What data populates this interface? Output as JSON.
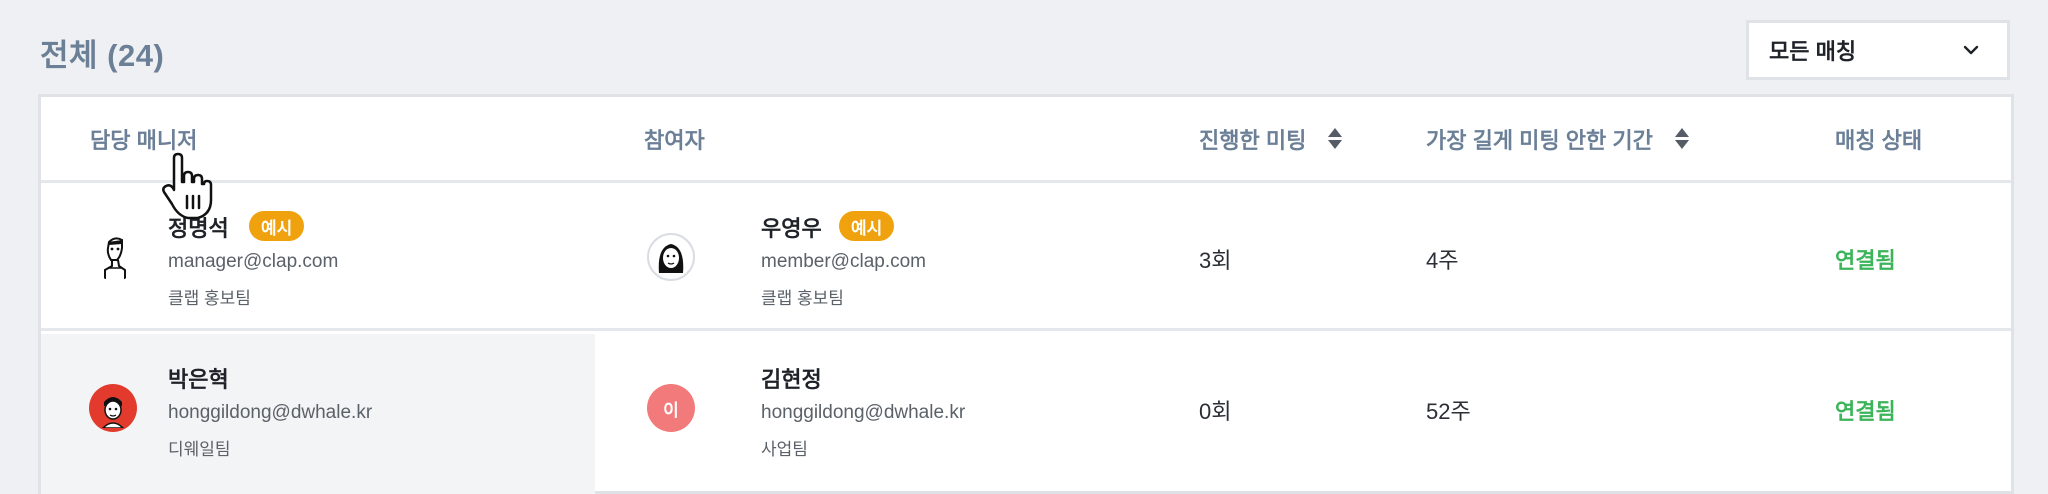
{
  "header": {
    "title": "전체 (24)",
    "filter": {
      "value": "모든 매칭"
    }
  },
  "table": {
    "columns": {
      "manager": "담당 매니저",
      "participant": "참여자",
      "meetings": "진행한 미팅",
      "longest_gap": "가장 길게 미팅 안한 기간",
      "status": "매칭 상태"
    },
    "rows": [
      {
        "manager": {
          "name": "정명석",
          "badge": "예시",
          "email": "manager@clap.com",
          "team": "클랩 홍보팀"
        },
        "participant": {
          "name": "우영우",
          "badge": "예시",
          "email": "member@clap.com",
          "team": "클랩 홍보팀"
        },
        "meetings": "3회",
        "longest_gap": "4주",
        "status": "연결됨"
      },
      {
        "manager": {
          "name": "박은혁",
          "email": "honggildong@dwhale.kr",
          "team": "디웨일팀"
        },
        "participant": {
          "name": "김현정",
          "avatar_initial": "이",
          "email": "honggildong@dwhale.kr",
          "team": "사업팀"
        },
        "meetings": "0회",
        "longest_gap": "52주",
        "status": "연결됨"
      }
    ]
  },
  "colors": {
    "badge": "#f0a20e",
    "status_connected": "#3cb55a",
    "header_text": "#6b7f97",
    "avatar_pink": "#f27a7a",
    "avatar_red": "#e23b2e"
  }
}
